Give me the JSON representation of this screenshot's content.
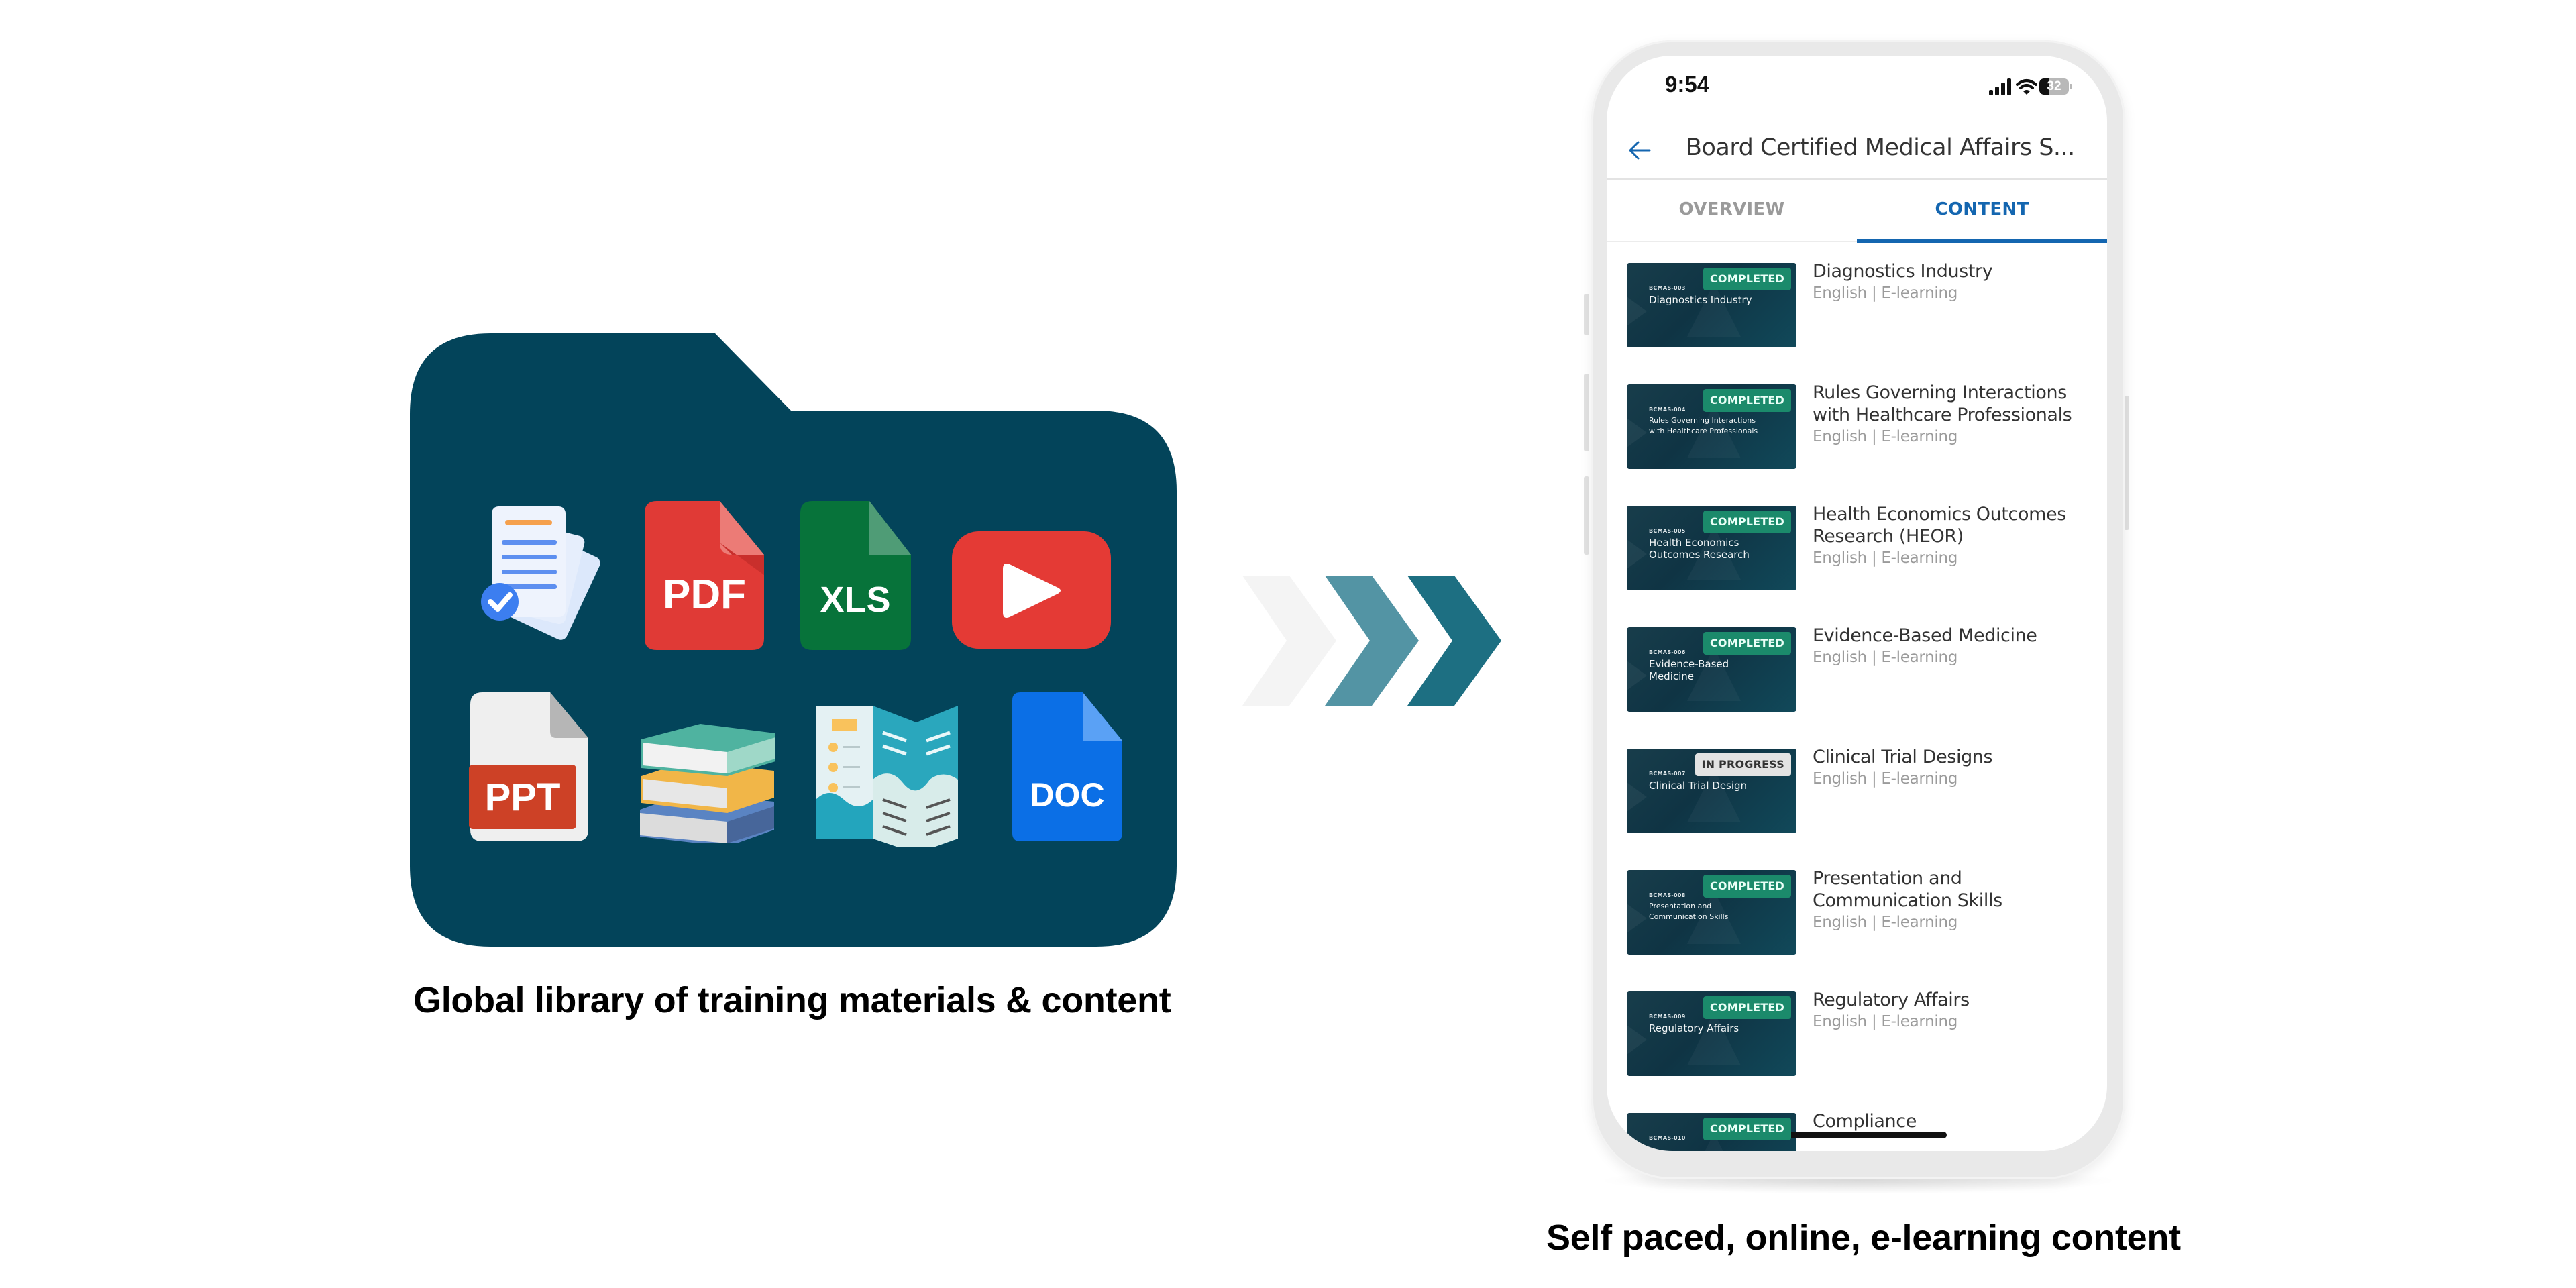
{
  "left_panel": {
    "caption": "Global library of training materials & content",
    "folder_color": "#03445a",
    "file_icons": [
      {
        "name": "documents-checked-icon",
        "label": ""
      },
      {
        "name": "pdf-file-icon",
        "label": "PDF",
        "color": "#e03a36"
      },
      {
        "name": "xls-file-icon",
        "label": "XLS",
        "color": "#07733a"
      },
      {
        "name": "video-play-icon",
        "label": "",
        "color": "#e43a35"
      },
      {
        "name": "ppt-file-icon",
        "label": "PPT",
        "color": "#cd4126"
      },
      {
        "name": "books-stack-icon",
        "label": ""
      },
      {
        "name": "brochure-icon",
        "label": ""
      },
      {
        "name": "doc-file-icon",
        "label": "DOC",
        "color": "#0b6fe6"
      }
    ]
  },
  "arrows": {
    "colors": [
      "#f4f4f4",
      "#5394a4",
      "#1d6f82"
    ]
  },
  "phone": {
    "status_bar": {
      "time": "9:54",
      "battery": "32",
      "battery_percent": 32
    },
    "header": {
      "back_icon": "arrow-left-icon",
      "title": "Board Certified Medical Affairs S..."
    },
    "tabs": [
      {
        "label": "OVERVIEW",
        "active": false
      },
      {
        "label": "CONTENT",
        "active": true
      }
    ],
    "accent_color": "#1466b0",
    "items": [
      {
        "code": "BCMAS-003",
        "thumb_title": "Diagnostics Industry",
        "status": "COMPLETED",
        "title": "Diagnostics Industry",
        "meta": "English | E-learning"
      },
      {
        "code": "BCMAS-004",
        "thumb_title": "Rules Governing Interactions with Healthcare Professionals",
        "status": "COMPLETED",
        "title": "Rules Governing Interactions with Healthcare Professionals",
        "meta": "English | E-learning"
      },
      {
        "code": "BCMAS-005",
        "thumb_title": "Health Economics Outcomes Research",
        "status": "COMPLETED",
        "title": "Health Economics Outcomes Research (HEOR)",
        "meta": "English | E-learning"
      },
      {
        "code": "BCMAS-006",
        "thumb_title": "Evidence-Based Medicine",
        "status": "COMPLETED",
        "title": "Evidence-Based Medicine",
        "meta": "English | E-learning"
      },
      {
        "code": "BCMAS-007",
        "thumb_title": "Clinical Trial Design",
        "status": "IN PROGRESS",
        "title": "Clinical Trial Designs",
        "meta": "English | E-learning"
      },
      {
        "code": "BCMAS-008",
        "thumb_title": "Presentation and Communication Skills",
        "status": "COMPLETED",
        "title": "Presentation and Communication Skills",
        "meta": "English | E-learning"
      },
      {
        "code": "BCMAS-009",
        "thumb_title": "Regulatory Affairs",
        "status": "COMPLETED",
        "title": "Regulatory Affairs",
        "meta": "English | E-learning"
      },
      {
        "code": "BCMAS-010",
        "thumb_title": "",
        "status": "COMPLETED",
        "title": "Compliance",
        "meta": ""
      }
    ]
  },
  "right_panel": {
    "caption": "Self paced, online, e-learning content"
  }
}
